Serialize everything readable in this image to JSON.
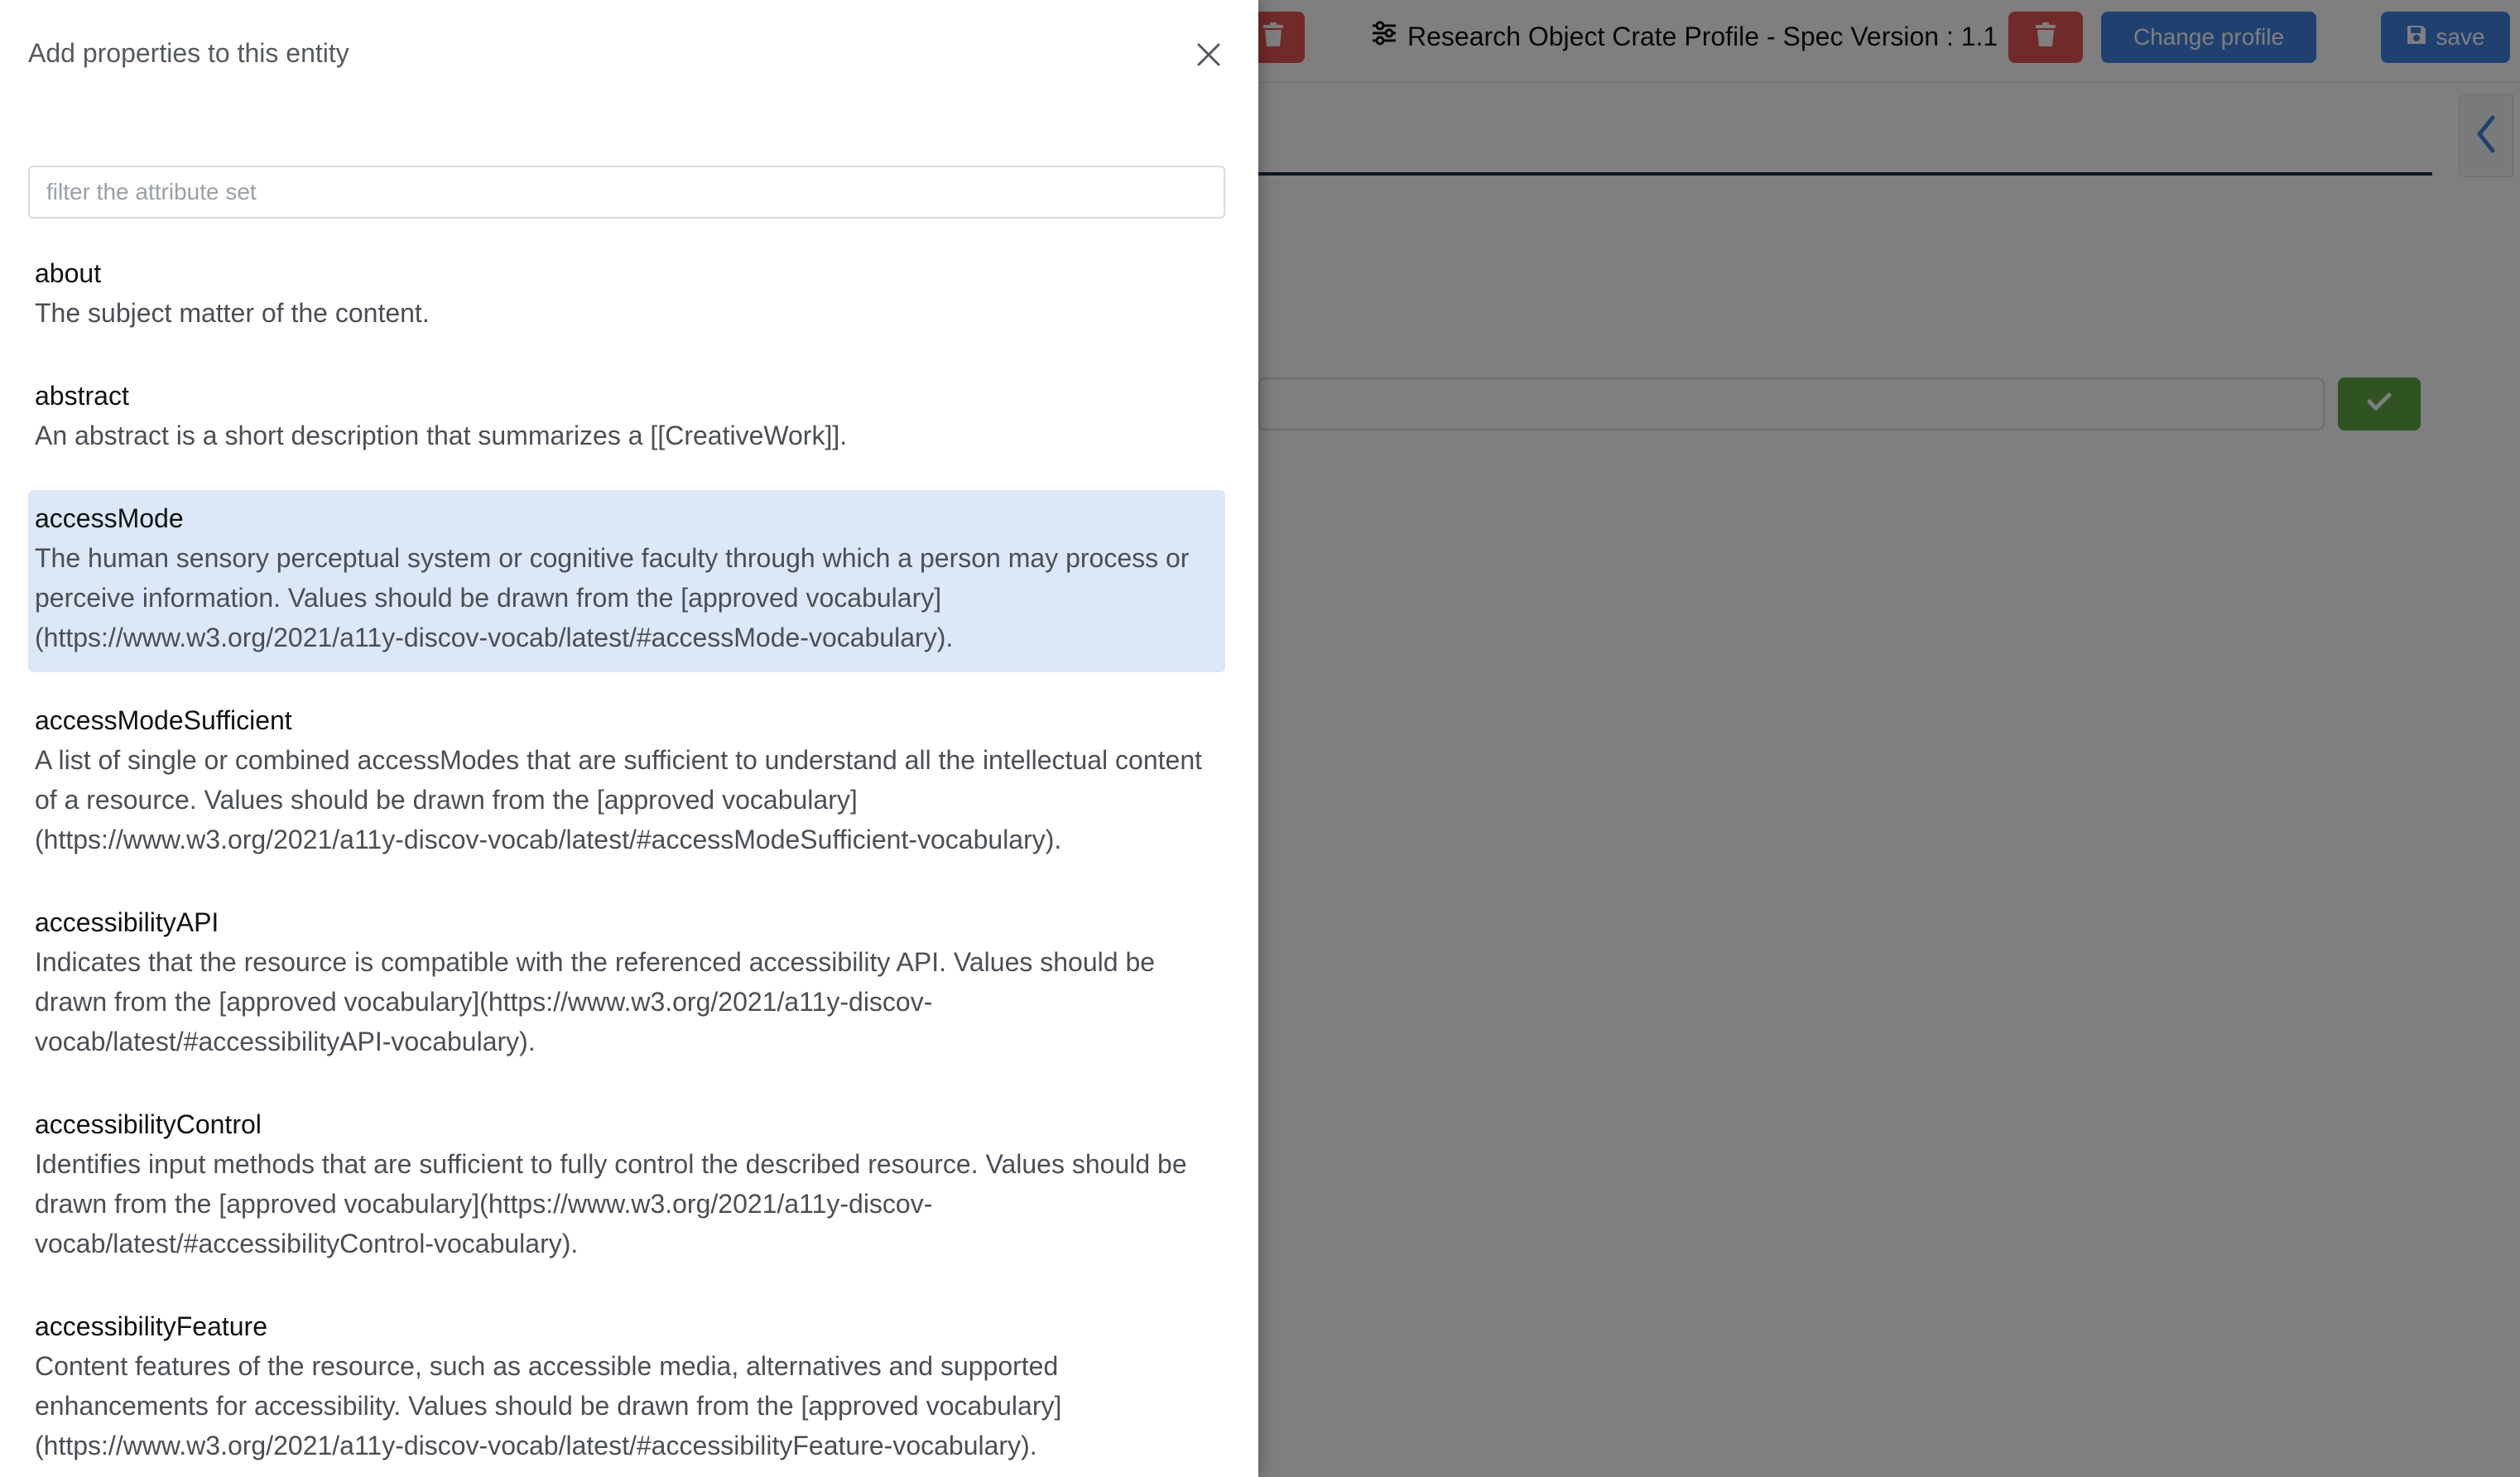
{
  "header": {
    "profile_label": "Research Object Crate Profile - Spec Version : 1.1",
    "change_profile_label": "Change profile",
    "save_label": "save"
  },
  "drawer": {
    "title": "Add properties to this entity",
    "filter_placeholder": "filter the attribute set",
    "filter_value": "",
    "properties": [
      {
        "name": "about",
        "description": "The subject matter of the content.",
        "selected": false
      },
      {
        "name": "abstract",
        "description": "An abstract is a short description that summarizes a [[CreativeWork]].",
        "selected": false
      },
      {
        "name": "accessMode",
        "description": "The human sensory perceptual system or cognitive faculty through which a person may process or perceive information. Values should be drawn from the [approved vocabulary](https://www.w3.org/2021/a11y-discov-vocab/latest/#accessMode-vocabulary).",
        "selected": true
      },
      {
        "name": "accessModeSufficient",
        "description": "A list of single or combined accessModes that are sufficient to understand all the intellectual content of a resource. Values should be drawn from the [approved vocabulary](https://www.w3.org/2021/a11y-discov-vocab/latest/#accessModeSufficient-vocabulary).",
        "selected": false
      },
      {
        "name": "accessibilityAPI",
        "description": "Indicates that the resource is compatible with the referenced accessibility API. Values should be drawn from the [approved vocabulary](https://www.w3.org/2021/a11y-discov-vocab/latest/#accessibilityAPI-vocabulary).",
        "selected": false
      },
      {
        "name": "accessibilityControl",
        "description": "Identifies input methods that are sufficient to fully control the described resource. Values should be drawn from the [approved vocabulary](https://www.w3.org/2021/a11y-discov-vocab/latest/#accessibilityControl-vocabulary).",
        "selected": false
      },
      {
        "name": "accessibilityFeature",
        "description": "Content features of the resource, such as accessible media, alternatives and supported enhancements for accessibility. Values should be drawn from the [approved vocabulary](https://www.w3.org/2021/a11y-discov-vocab/latest/#accessibilityFeature-vocabulary).",
        "selected": false
      }
    ]
  },
  "colors": {
    "danger": "#e25555",
    "primary": "#3f82e0",
    "success": "#5fa844",
    "selected_row": "#dce7f7"
  },
  "icons": {
    "profile": "sliders-icon",
    "delete": "trash-icon",
    "save": "floppy-disk-icon",
    "collapse": "chevron-left-icon",
    "confirm": "check-icon",
    "close": "close-icon"
  }
}
